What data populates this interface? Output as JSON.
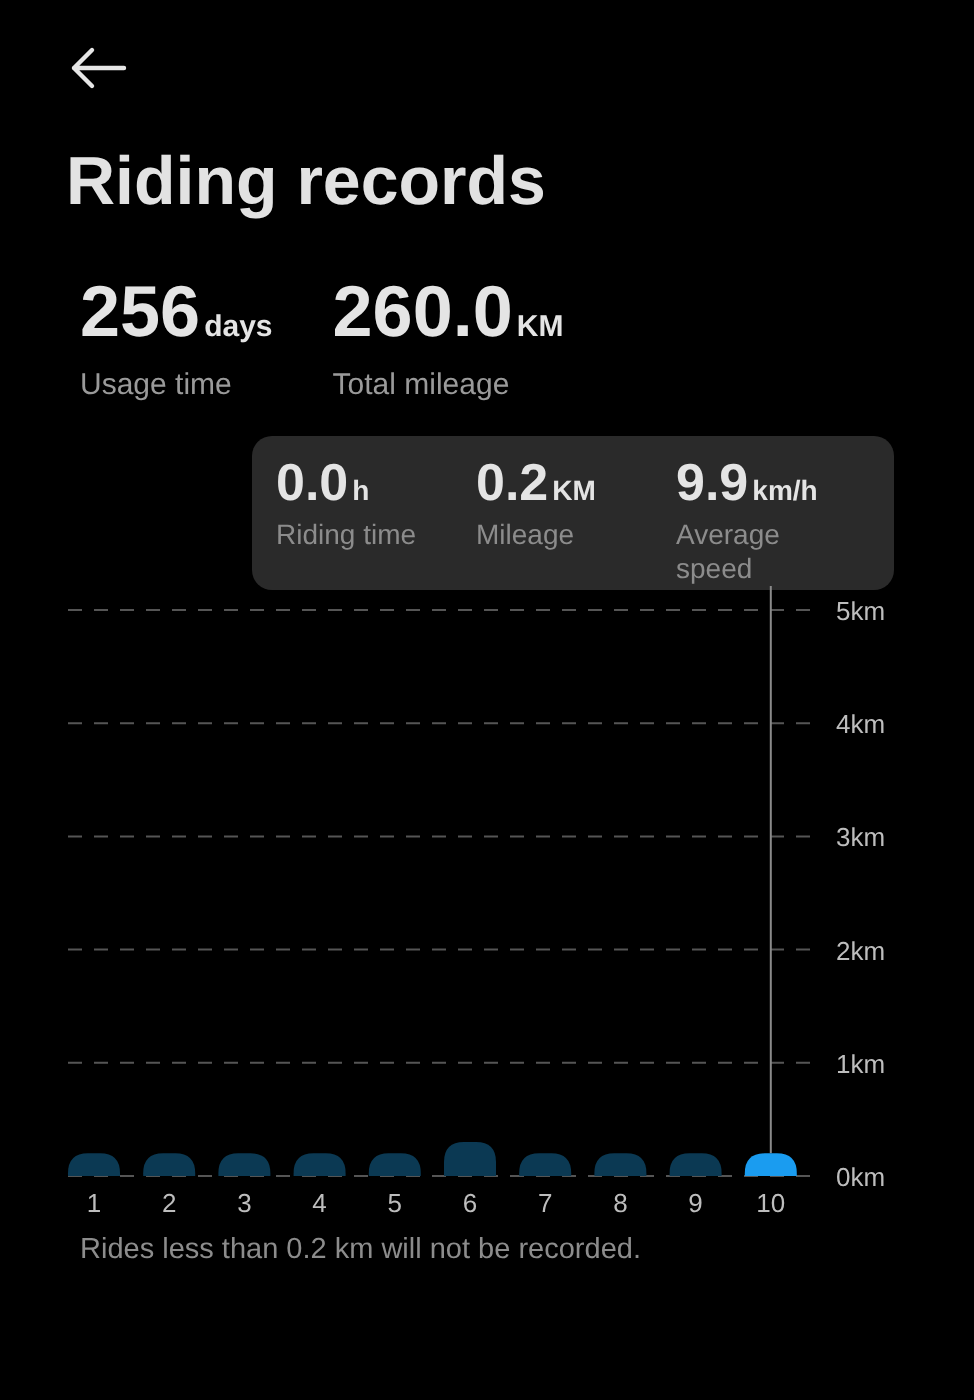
{
  "title": "Riding records",
  "summary": [
    {
      "value": "256",
      "unit": "days",
      "label": "Usage time"
    },
    {
      "value": "260.0",
      "unit": "KM",
      "label": "Total mileage"
    }
  ],
  "detail_card": [
    {
      "value": "0.0",
      "unit": "h",
      "label": "Riding time"
    },
    {
      "value": "0.2",
      "unit": "KM",
      "label": "Mileage"
    },
    {
      "value": "9.9",
      "unit": "km/h",
      "label": "Average speed"
    }
  ],
  "chart": {
    "chart_data": {
      "type": "bar",
      "categories": [
        "1",
        "2",
        "3",
        "4",
        "5",
        "6",
        "7",
        "8",
        "9",
        "10"
      ],
      "values": [
        0.2,
        0.2,
        0.2,
        0.2,
        0.2,
        0.3,
        0.2,
        0.2,
        0.2,
        0.2
      ],
      "ylim": [
        0,
        5
      ],
      "grid": true,
      "yticks": [
        {
          "value": 0,
          "label": "0km"
        },
        {
          "value": 1,
          "label": "1km"
        },
        {
          "value": 2,
          "label": "2km"
        },
        {
          "value": 3,
          "label": "3km"
        },
        {
          "value": 4,
          "label": "4km"
        },
        {
          "value": 5,
          "label": "5km"
        }
      ]
    },
    "bars": [
      {
        "selected": false
      },
      {
        "selected": false
      },
      {
        "selected": false
      },
      {
        "selected": false
      },
      {
        "selected": false
      },
      {
        "selected": false
      },
      {
        "selected": false
      },
      {
        "selected": false
      },
      {
        "selected": false
      },
      {
        "selected": true
      }
    ]
  },
  "footnote": "Rides less than 0.2 km will not be recorded."
}
